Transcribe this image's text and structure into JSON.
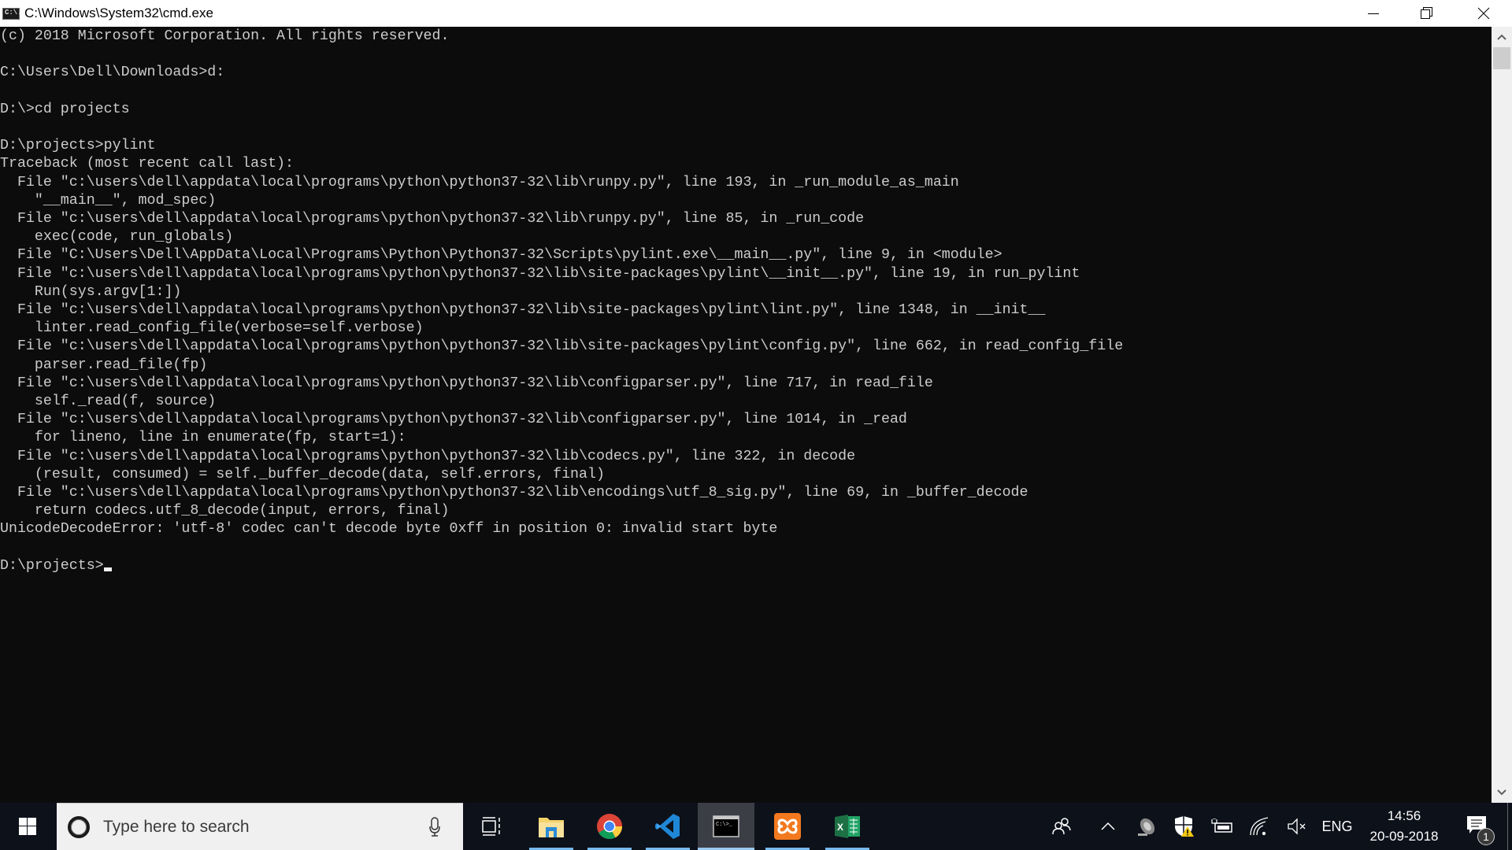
{
  "window": {
    "title": "C:\\Windows\\System32\\cmd.exe",
    "icon": "cmd-app-icon",
    "controls": {
      "minimize": "minimize",
      "maximize": "restore",
      "close": "close"
    }
  },
  "console": {
    "lines": [
      "(c) 2018 Microsoft Corporation. All rights reserved.",
      "",
      "C:\\Users\\Dell\\Downloads>d:",
      "",
      "D:\\>cd projects",
      "",
      "D:\\projects>pylint",
      "Traceback (most recent call last):",
      "  File \"c:\\users\\dell\\appdata\\local\\programs\\python\\python37-32\\lib\\runpy.py\", line 193, in _run_module_as_main",
      "    \"__main__\", mod_spec)",
      "  File \"c:\\users\\dell\\appdata\\local\\programs\\python\\python37-32\\lib\\runpy.py\", line 85, in _run_code",
      "    exec(code, run_globals)",
      "  File \"C:\\Users\\Dell\\AppData\\Local\\Programs\\Python\\Python37-32\\Scripts\\pylint.exe\\__main__.py\", line 9, in <module>",
      "  File \"c:\\users\\dell\\appdata\\local\\programs\\python\\python37-32\\lib\\site-packages\\pylint\\__init__.py\", line 19, in run_pylint",
      "    Run(sys.argv[1:])",
      "  File \"c:\\users\\dell\\appdata\\local\\programs\\python\\python37-32\\lib\\site-packages\\pylint\\lint.py\", line 1348, in __init__",
      "    linter.read_config_file(verbose=self.verbose)",
      "  File \"c:\\users\\dell\\appdata\\local\\programs\\python\\python37-32\\lib\\site-packages\\pylint\\config.py\", line 662, in read_config_file",
      "    parser.read_file(fp)",
      "  File \"c:\\users\\dell\\appdata\\local\\programs\\python\\python37-32\\lib\\configparser.py\", line 717, in read_file",
      "    self._read(f, source)",
      "  File \"c:\\users\\dell\\appdata\\local\\programs\\python\\python37-32\\lib\\configparser.py\", line 1014, in _read",
      "    for lineno, line in enumerate(fp, start=1):",
      "  File \"c:\\users\\dell\\appdata\\local\\programs\\python\\python37-32\\lib\\codecs.py\", line 322, in decode",
      "    (result, consumed) = self._buffer_decode(data, self.errors, final)",
      "  File \"c:\\users\\dell\\appdata\\local\\programs\\python\\python37-32\\lib\\encodings\\utf_8_sig.py\", line 69, in _buffer_decode",
      "    return codecs.utf_8_decode(input, errors, final)",
      "UnicodeDecodeError: 'utf-8' codec can't decode byte 0xff in position 0: invalid start byte",
      ""
    ],
    "prompt": "D:\\projects>",
    "colors": {
      "background": "#0c0c0c",
      "foreground": "#cccccc"
    }
  },
  "scrollbar": {
    "up_icon": "chevron-up-icon",
    "down_icon": "chevron-down-icon"
  },
  "taskbar": {
    "start_icon": "windows-logo-icon",
    "search": {
      "placeholder": "Type here to search",
      "icon": "cortana-icon",
      "mic_icon": "microphone-icon"
    },
    "apps": [
      {
        "name": "Task View",
        "icon": "task-view-icon",
        "running": false,
        "active": false
      },
      {
        "name": "File Explorer",
        "icon": "file-explorer-icon",
        "running": true,
        "active": false
      },
      {
        "name": "Google Chrome",
        "icon": "chrome-icon",
        "running": true,
        "active": false
      },
      {
        "name": "Visual Studio Code",
        "icon": "vscode-icon",
        "running": true,
        "active": false
      },
      {
        "name": "Command Prompt",
        "icon": "cmd-icon",
        "running": true,
        "active": true
      },
      {
        "name": "XAMPP",
        "icon": "xampp-icon",
        "running": true,
        "active": false
      },
      {
        "name": "Excel",
        "icon": "excel-icon",
        "running": true,
        "active": false
      }
    ],
    "tray": {
      "people_icon": "people-icon",
      "overflow_icon": "chevron-up-icon",
      "speaker_app_icon": "speaker-app-icon",
      "security_icon": "defender-warning-icon",
      "battery_icon": "battery-charging-icon",
      "network_icon": "wifi-icon",
      "volume_icon": "volume-muted-icon",
      "language": "ENG",
      "time": "14:56",
      "date": "20-09-2018",
      "notifications_count": "1"
    }
  }
}
